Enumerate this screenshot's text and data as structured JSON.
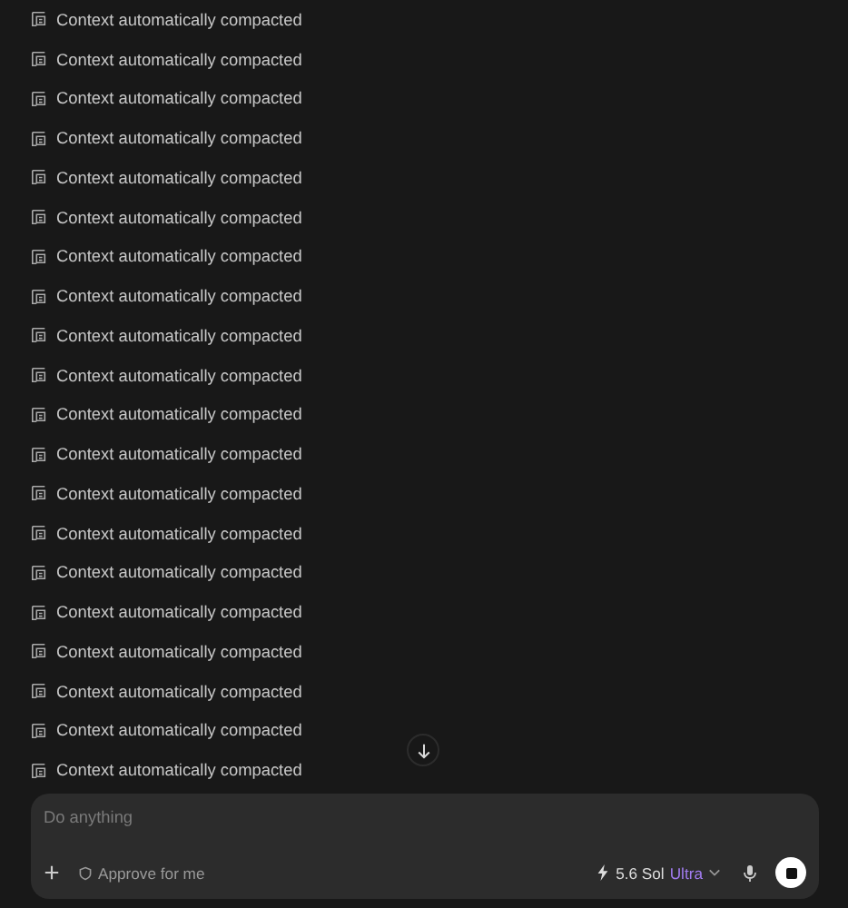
{
  "events": [
    {
      "text": "Context automatically compacted"
    },
    {
      "text": "Context automatically compacted"
    },
    {
      "text": "Context automatically compacted"
    },
    {
      "text": "Context automatically compacted"
    },
    {
      "text": "Context automatically compacted"
    },
    {
      "text": "Context automatically compacted"
    },
    {
      "text": "Context automatically compacted"
    },
    {
      "text": "Context automatically compacted"
    },
    {
      "text": "Context automatically compacted"
    },
    {
      "text": "Context automatically compacted"
    },
    {
      "text": "Context automatically compacted"
    },
    {
      "text": "Context automatically compacted"
    },
    {
      "text": "Context automatically compacted"
    },
    {
      "text": "Context automatically compacted"
    },
    {
      "text": "Context automatically compacted"
    },
    {
      "text": "Context automatically compacted"
    },
    {
      "text": "Context automatically compacted"
    },
    {
      "text": "Context automatically compacted"
    },
    {
      "text": "Context automatically compacted"
    },
    {
      "text": "Context automatically compacted"
    }
  ],
  "composer": {
    "placeholder": "Do anything",
    "approval": "Approve for me",
    "model": "5.6 Sol",
    "tier": "Ultra"
  }
}
